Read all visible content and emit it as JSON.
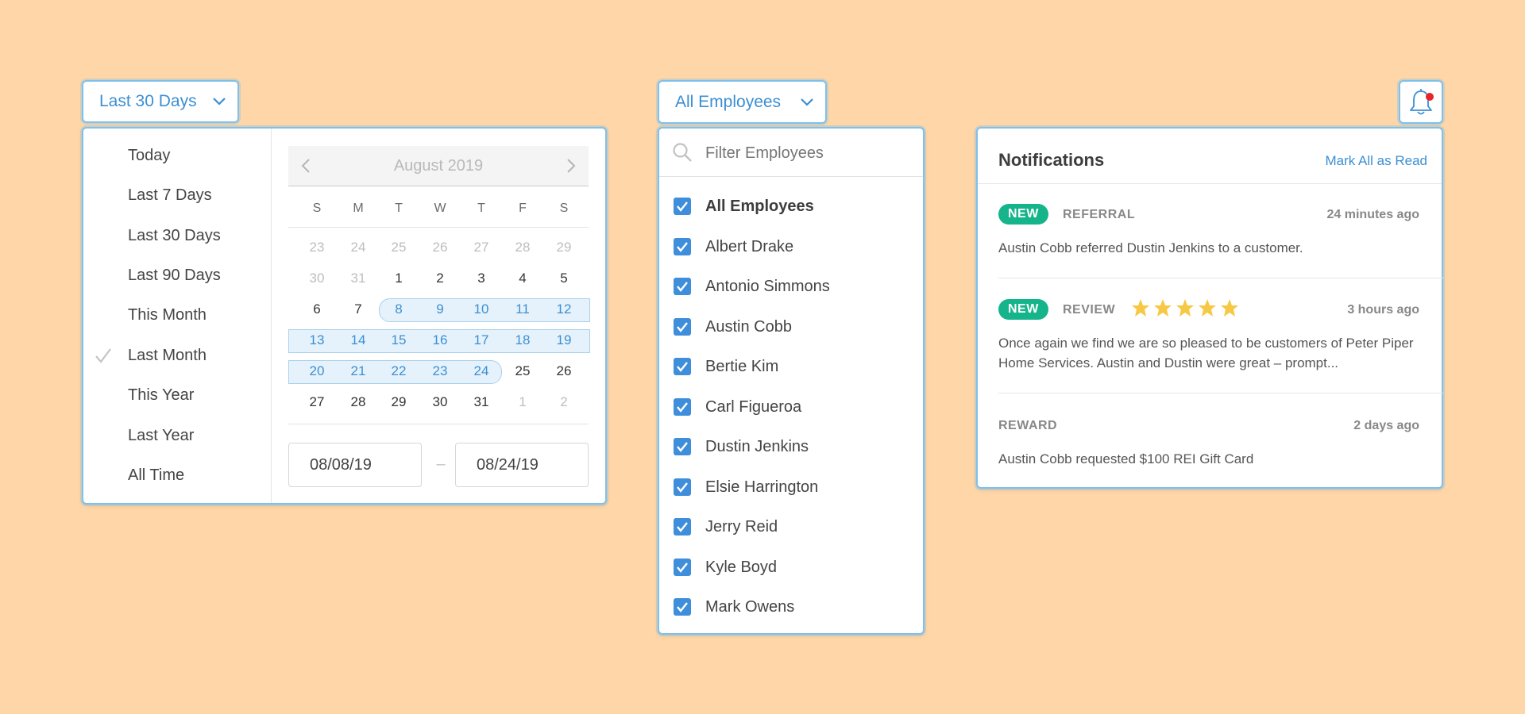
{
  "date_dropdown": {
    "label": "Last 30 Days",
    "presets": [
      "Today",
      "Last 7 Days",
      "Last 30 Days",
      "Last 90 Days",
      "This Month",
      "Last Month",
      "This Year",
      "Last Year",
      "All Time"
    ],
    "selected_preset": "Last Month",
    "calendar": {
      "month_label": "August 2019",
      "weekdays": [
        "S",
        "M",
        "T",
        "W",
        "T",
        "F",
        "S"
      ],
      "weeks": [
        [
          "23",
          "24",
          "25",
          "26",
          "27",
          "28",
          "29"
        ],
        [
          "30",
          "31",
          "1",
          "2",
          "3",
          "4",
          "5"
        ],
        [
          "6",
          "7",
          "8",
          "9",
          "10",
          "11",
          "12"
        ],
        [
          "13",
          "14",
          "15",
          "16",
          "17",
          "18",
          "19"
        ],
        [
          "20",
          "21",
          "22",
          "23",
          "24",
          "25",
          "26"
        ],
        [
          "27",
          "28",
          "29",
          "30",
          "31",
          "1",
          "2"
        ]
      ]
    },
    "start_date": "08/08/19",
    "range_separator": "–",
    "end_date": "08/24/19"
  },
  "employees_dropdown": {
    "label": "All Employees",
    "filter_placeholder": "Filter Employees",
    "options": [
      {
        "label": "All Employees",
        "checked": true
      },
      {
        "label": "Albert Drake",
        "checked": true
      },
      {
        "label": "Antonio Simmons",
        "checked": true
      },
      {
        "label": "Austin Cobb",
        "checked": true
      },
      {
        "label": "Bertie Kim",
        "checked": true
      },
      {
        "label": "Carl Figueroa",
        "checked": true
      },
      {
        "label": "Dustin Jenkins",
        "checked": true
      },
      {
        "label": "Elsie Harrington",
        "checked": true
      },
      {
        "label": "Jerry Reid",
        "checked": true
      },
      {
        "label": "Kyle Boyd",
        "checked": true
      },
      {
        "label": "Mark Owens",
        "checked": true
      }
    ]
  },
  "notifications": {
    "bell_icon": "bell-icon",
    "unread_dot_color": "#e8232b",
    "title": "Notifications",
    "mark_all_label": "Mark All as Read",
    "items": [
      {
        "badge": "NEW",
        "type": "REFERRAL",
        "time": "24 minutes ago",
        "text": "Austin Cobb referred Dustin Jenkins to a customer."
      },
      {
        "badge": "NEW",
        "type": "REVIEW",
        "rating": 5,
        "time": "3 hours ago",
        "text": "Once again we find we are so pleased to be customers of Peter Piper Home Services. Austin and Dustin were great – prompt..."
      },
      {
        "type": "REWARD",
        "time": "2 days ago",
        "text": "Austin Cobb requested $100 REI Gift Card"
      }
    ]
  },
  "colors": {
    "background": "#fed6a7",
    "accent_blue": "#3b8fd3",
    "new_badge": "#15b48a",
    "star": "#f6c844"
  }
}
